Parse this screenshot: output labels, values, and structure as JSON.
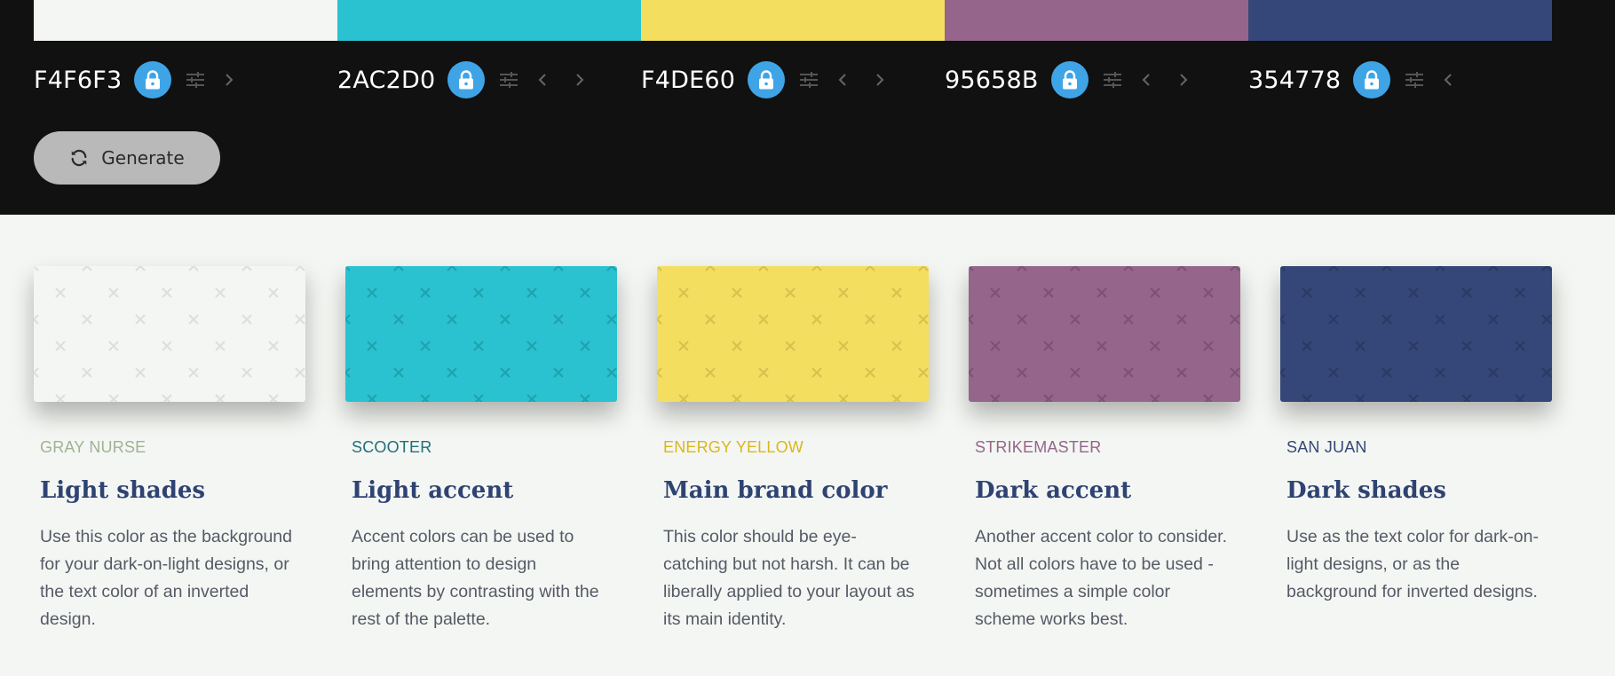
{
  "colors": [
    {
      "hex": "F4F6F3",
      "swatch": "#f4f6f3",
      "mark": "#dedfdd",
      "name": "GRAY NURSE",
      "name_color": "#a0b294",
      "title": "Light shades",
      "desc": "Use this color as the background for your dark-on-light designs, or the text color of an inverted design.",
      "prev_arrow": false,
      "next_arrow": true
    },
    {
      "hex": "2AC2D0",
      "swatch": "#2ac2d0",
      "mark": "#1fa3af",
      "name": "SCOOTER",
      "name_color": "#1f6f78",
      "title": "Light accent",
      "desc": "Accent colors can be used to bring attention to design elements by contrasting with the rest of the palette.",
      "prev_arrow": true,
      "next_arrow": true
    },
    {
      "hex": "F4DE60",
      "swatch": "#f4de60",
      "mark": "#d8c24e",
      "name": "ENERGY YELLOW",
      "name_color": "#d9b71c",
      "title": "Main brand color",
      "desc": "This color should be eye-catching but not harsh. It can be liberally applied to your layout as its main identity.",
      "prev_arrow": true,
      "next_arrow": true
    },
    {
      "hex": "95658B",
      "swatch": "#95658b",
      "mark": "#7d5273",
      "name": "STRIKEMASTER",
      "name_color": "#95658b",
      "title": "Dark accent",
      "desc": "Another accent color to consider. Not all colors have to be used - sometimes a simple color scheme works best.",
      "prev_arrow": true,
      "next_arrow": true
    },
    {
      "hex": "354778",
      "swatch": "#354778",
      "mark": "#2a3a63",
      "name": "SAN JUAN",
      "name_color": "#354778",
      "title": "Dark shades",
      "desc": "Use as the text color for dark-on-light designs, or as the background for inverted designs.",
      "prev_arrow": true,
      "next_arrow": false
    }
  ],
  "generate": {
    "label": "Generate",
    "icon": "refresh-icon"
  },
  "theme": {
    "topbar_bg": "#111111",
    "page_bg": "#f4f6f3",
    "lock_bg": "#3fa4e6",
    "button_bg": "#b9b9b9",
    "title_color": "#2f4373"
  }
}
